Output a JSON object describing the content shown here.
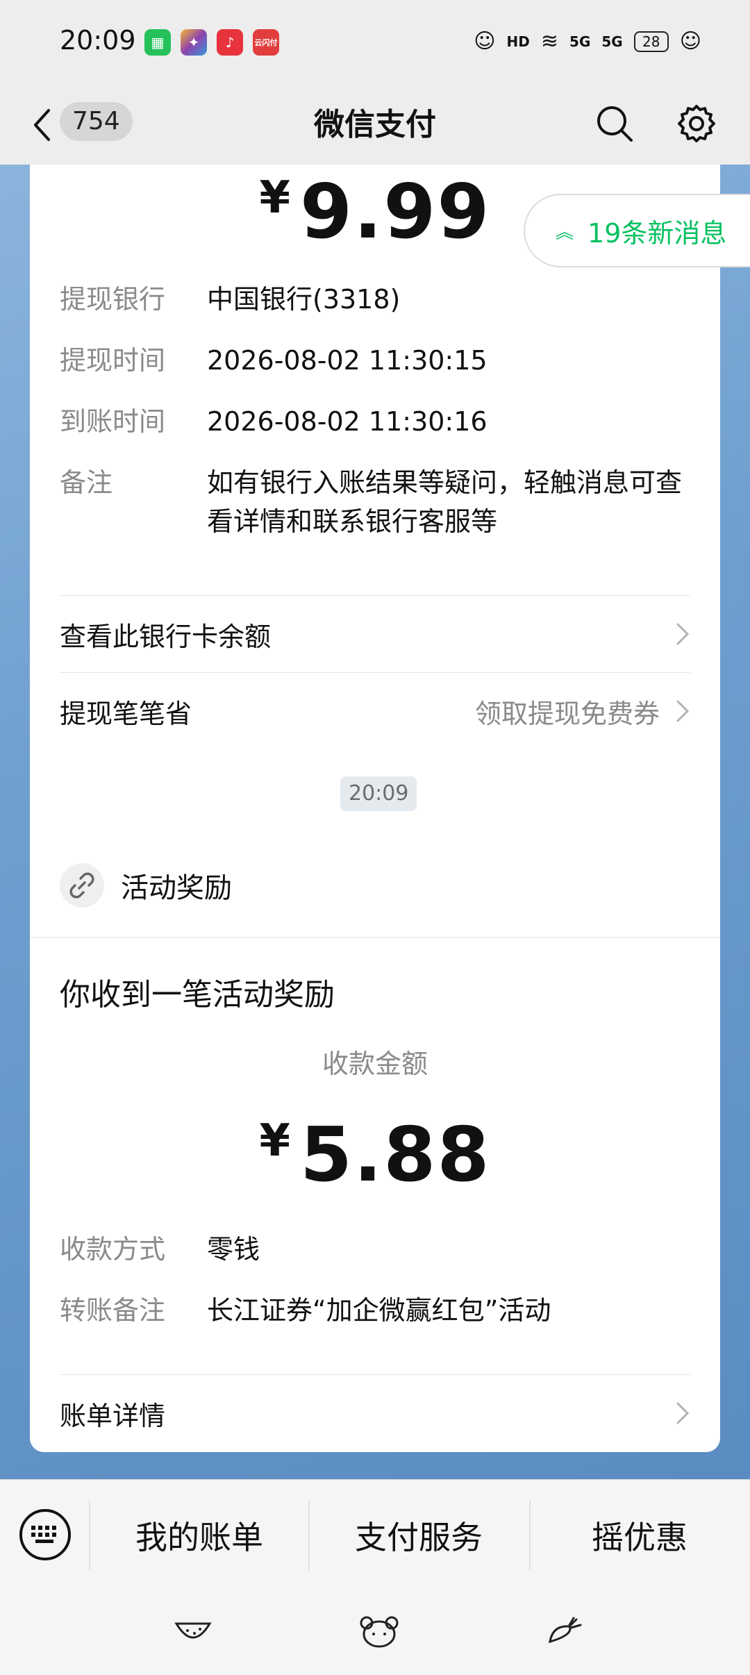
{
  "status_bar": {
    "time": "20:09",
    "app_badge_text": "云闪付",
    "network_1": "5G",
    "network_2": "5G",
    "battery": "28"
  },
  "nav": {
    "unread_count": "754",
    "title": "微信支付"
  },
  "withdraw_card": {
    "amount": "9.99",
    "currency_symbol": "¥",
    "new_messages": "19条新消息",
    "rows": [
      {
        "key": "提现银行",
        "value": "中国银行(3318)"
      },
      {
        "key": "提现时间",
        "value": "2026-08-02 11:30:15"
      },
      {
        "key": "到账时间",
        "value": "2026-08-02 11:30:16"
      },
      {
        "key": "备注",
        "value": "如有银行入账结果等疑问，轻触消息可查看详情和联系银行客服等"
      }
    ],
    "link_balance": "查看此银行卡余额",
    "link_save": "提现笔笔省",
    "link_save_hint": "领取提现免费券"
  },
  "time_chip": "20:09",
  "reward_card": {
    "header": "活动奖励",
    "title": "你收到一笔活动奖励",
    "amount_label": "收款金额",
    "currency_symbol": "¥",
    "amount": "5.88",
    "rows": [
      {
        "key": "收款方式",
        "value": "零钱"
      },
      {
        "key": "转账备注",
        "value": "长江证券“加企微赢红包”活动"
      }
    ],
    "link_details": "账单详情"
  },
  "bottom_menu": {
    "items": [
      "我的账单",
      "支付服务",
      "摇优惠"
    ]
  },
  "colors": {
    "accent_green": "#07c160",
    "chat_bg": "#6f9fcf"
  }
}
